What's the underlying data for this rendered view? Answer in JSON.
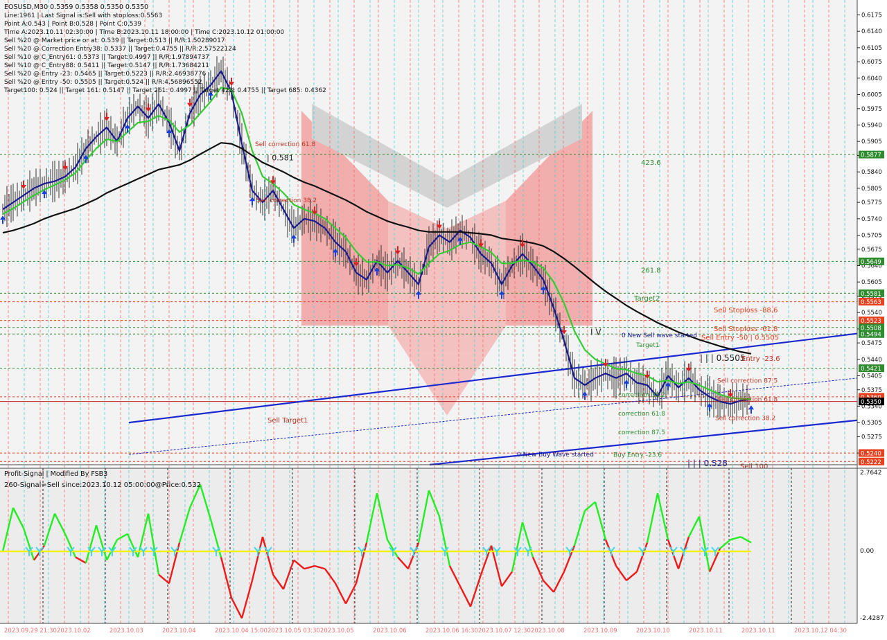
{
  "main_header": {
    "symbol_line": "EOSUSD,M30  0.5359 0.5358 0.5350 0.5350",
    "info_lines": [
      "Line:1961 | Last Signal is:Sell with stoploss:0.5563",
      "Point A:0.543 | Point B:0.528 | Point C:0.539",
      "Time A:2023.10.11 02:30:00 | Time B:2023.10.11 18:00:00 | Time C:2023.10.12 01:00:00",
      "Sell %20 @ Market price or at: 0.539 || Target:0.513 || R/R:1.50289017",
      "Sell %20 @ Correction Entry38: 0.5337 || Target:0.4755 || R/R:2.57522124",
      "Sell %10 @ C_Entry61: 0.5373 || Target:0.4997 || R/R:1.97894737",
      "Sell %10 @ C_Entry88: 0.5411 || Target:0.5147 || R/R:1.73684211",
      "Sell %20 @ Entry -23: 0.5465 || Target:0.5223 || R/R:2.46938776",
      "Sell %20 @ Entry -50: 0.5505 || Target:0.524 || R/R:4.56896552",
      "Target100: 0.524 || Target 161: 0.5147 || Target 261: 0.4997 || Target 423: 0.4755 || Target 685: 0.4362"
    ]
  },
  "price_axis": {
    "ticks": [
      "0.6175",
      "0.6140",
      "0.6105",
      "0.6075",
      "0.6040",
      "0.6005",
      "0.5975",
      "0.5940",
      "0.5905",
      "0.5875",
      "0.5840",
      "0.5805",
      "0.5775",
      "0.5740",
      "0.5705",
      "0.5675",
      "0.5640",
      "0.5605",
      "0.5575",
      "0.5540",
      "0.5505",
      "0.5475",
      "0.5440",
      "0.5405",
      "0.5375",
      "0.5340",
      "0.5305",
      "0.5275",
      "0.5240"
    ],
    "tags": [
      {
        "label": "0.5877",
        "bg": "#2e8b2e"
      },
      {
        "label": "0.5649",
        "bg": "#2e8b2e"
      },
      {
        "label": "0.5581",
        "bg": "#2e8b2e"
      },
      {
        "label": "0.5563",
        "bg": "#e8401c"
      },
      {
        "label": "0.5523",
        "bg": "#e8401c"
      },
      {
        "label": "0.5508",
        "bg": "#2e8b2e"
      },
      {
        "label": "0.5494",
        "bg": "#2e8b2e"
      },
      {
        "label": "0.5421",
        "bg": "#2e8b2e"
      },
      {
        "label": "0.5360",
        "bg": "#e8401c"
      },
      {
        "label": "0.5350",
        "bg": "#000000"
      },
      {
        "label": "0.5240",
        "bg": "#e8401c"
      },
      {
        "label": "0.5222",
        "bg": "#e8401c"
      }
    ]
  },
  "chart_labels": [
    {
      "text": "Sell correction 61.8",
      "color": "#c03020"
    },
    {
      "text": "| 0.581",
      "color": "#222222"
    },
    {
      "text": "Sell correction 38.2",
      "color": "#c03020"
    },
    {
      "text": "423.6",
      "color": "#2e8b2e"
    },
    {
      "text": "261.8",
      "color": "#2e8b2e"
    },
    {
      "text": "Target2",
      "color": "#2e8b2e"
    },
    {
      "text": "Sell Stoploss -88.6",
      "color": "#e8401c"
    },
    {
      "text": "Sell Stoploss -61.8",
      "color": "#e8401c"
    },
    {
      "text": "Sell Entry -50 | 0.5505",
      "color": "#e8401c"
    },
    {
      "text": "0 New Sell wave started",
      "color": "#1a1a90"
    },
    {
      "text": "Target1",
      "color": "#2e8b2e"
    },
    {
      "text": "| | | 0.5505",
      "color": "#222222"
    },
    {
      "text": "Entry -23.6",
      "color": "#c03020"
    },
    {
      "text": "I V",
      "color": "#222222"
    },
    {
      "text": "Sell correction 87.5",
      "color": "#c03020"
    },
    {
      "text": "Sell correction 61.8",
      "color": "#c03020"
    },
    {
      "text": "Sell correction 38.2",
      "color": "#c03020"
    },
    {
      "text": "correction 38.2",
      "color": "#2e8b2e"
    },
    {
      "text": "correction 61.8",
      "color": "#2e8b2e"
    },
    {
      "text": "correction 87.5",
      "color": "#2e8b2e"
    },
    {
      "text": "Sell Target1",
      "color": "#c03020"
    },
    {
      "text": "0 New Buy Wave started",
      "color": "#1a1a90"
    },
    {
      "text": "Buy Entry -23.6",
      "color": "#2e8b2e"
    },
    {
      "text": "| | | 0.528",
      "color": "#1a1a90"
    },
    {
      "text": "Sell 100",
      "color": "#c03020"
    }
  ],
  "sub_header": {
    "title": "Profit-Signal | Modified By FSB3",
    "signal": "260-Signal=Sell since:2023.10.12 05:00:00@Price:0.532"
  },
  "sub_axis": {
    "top": "2.7642",
    "zero": "0.00",
    "bottom": "-2.4287"
  },
  "time_axis": [
    "2023.09.29 21:30",
    "2023.10.02",
    "2023.10.03",
    "2023.10.04",
    "2023.10.04 15:00",
    "2023.10.05 03:30",
    "2023.10.05",
    "2023.10.06",
    "2023.10.06 16:30",
    "2023.10.07 12:30",
    "2023.10.08",
    "2023.10.09",
    "2023.10.10",
    "2023.10.11",
    "2023.10.11",
    "2023.10.12 04:30"
  ],
  "chart_data": [
    {
      "type": "line",
      "title": "EOSUSD,M30",
      "ylim": [
        0.5215,
        0.6195
      ],
      "x": [
        0,
        15,
        30,
        45,
        60,
        75,
        90,
        105,
        120,
        135,
        150,
        165,
        180,
        195,
        210,
        225,
        240,
        255,
        270,
        285,
        300,
        315,
        330,
        345,
        360,
        375,
        390,
        405,
        420,
        435,
        450,
        465,
        480,
        495,
        510,
        525,
        540,
        555,
        570,
        585,
        600,
        615,
        630,
        645,
        660,
        675,
        690,
        705,
        720,
        735,
        750,
        765,
        780,
        795,
        810,
        825,
        840,
        855,
        870,
        885,
        900,
        915,
        930,
        945,
        960,
        975,
        990,
        1005,
        1020,
        1035,
        1050,
        1065,
        1080
      ],
      "series": [
        {
          "values": [
            0.576,
            0.5775,
            0.579,
            0.5805,
            0.5815,
            0.582,
            0.583,
            0.585,
            0.589,
            0.5915,
            0.5935,
            0.5905,
            0.5955,
            0.598,
            0.5955,
            0.5985,
            0.5945,
            0.5885,
            0.5965,
            0.6005,
            0.6025,
            0.6055,
            0.601,
            0.59,
            0.58,
            0.5775,
            0.58,
            0.576,
            0.572,
            0.574,
            0.5735,
            0.572,
            0.569,
            0.567,
            0.5625,
            0.561,
            0.565,
            0.5625,
            0.565,
            0.5625,
            0.56,
            0.568,
            0.5705,
            0.569,
            0.5715,
            0.57,
            0.5665,
            0.5645,
            0.56,
            0.564,
            0.5665,
            0.564,
            0.561,
            0.555,
            0.548,
            0.54,
            0.5385,
            0.54,
            0.541,
            0.54,
            0.541,
            0.539,
            0.5385,
            0.536,
            0.5405,
            0.538,
            0.54,
            0.5375,
            0.536,
            0.535,
            0.5345,
            0.5352,
            0.5355
          ]
        },
        {
          "values": [
            0.575,
            0.5762,
            0.5776,
            0.579,
            0.5802,
            0.5812,
            0.5823,
            0.5838,
            0.5865,
            0.589,
            0.591,
            0.5905,
            0.5925,
            0.5945,
            0.5948,
            0.596,
            0.595,
            0.5925,
            0.594,
            0.5965,
            0.599,
            0.602,
            0.6015,
            0.5965,
            0.5885,
            0.583,
            0.5815,
            0.5795,
            0.577,
            0.576,
            0.5752,
            0.574,
            0.572,
            0.57,
            0.567,
            0.5648,
            0.5648,
            0.564,
            0.5642,
            0.5635,
            0.5622,
            0.5645,
            0.5665,
            0.5672,
            0.5685,
            0.569,
            0.568,
            0.5668,
            0.5645,
            0.5645,
            0.5652,
            0.5648,
            0.5635,
            0.5605,
            0.556,
            0.55,
            0.546,
            0.544,
            0.543,
            0.542,
            0.5418,
            0.541,
            0.5405,
            0.5392,
            0.5395,
            0.5388,
            0.5392,
            0.5385,
            0.5375,
            0.5365,
            0.5358,
            0.5356,
            0.5355
          ]
        },
        {
          "values": [
            0.571,
            0.5715,
            0.5722,
            0.573,
            0.574,
            0.5748,
            0.5755,
            0.5762,
            0.5772,
            0.5782,
            0.5795,
            0.5805,
            0.5815,
            0.5825,
            0.5835,
            0.5845,
            0.585,
            0.5855,
            0.5865,
            0.5878,
            0.589,
            0.5902,
            0.59,
            0.589,
            0.5875,
            0.586,
            0.585,
            0.584,
            0.5828,
            0.5818,
            0.581,
            0.58,
            0.579,
            0.578,
            0.5768,
            0.5755,
            0.5745,
            0.5735,
            0.5728,
            0.5722,
            0.5715,
            0.5712,
            0.5712,
            0.5712,
            0.5712,
            0.571,
            0.5708,
            0.5705,
            0.5698,
            0.5695,
            0.5692,
            0.5688,
            0.5682,
            0.567,
            0.5655,
            0.5638,
            0.562,
            0.5602,
            0.5585,
            0.557,
            0.5555,
            0.5542,
            0.553,
            0.5518,
            0.5508,
            0.5498,
            0.549,
            0.5482,
            0.5475,
            0.5468,
            0.5462,
            0.5456,
            0.5452
          ]
        }
      ]
    },
    {
      "type": "line",
      "title": "Profit-Signal | Modified By FSB3",
      "ylim": [
        -2.4287,
        2.7642
      ],
      "x": [
        0,
        15,
        30,
        45,
        60,
        75,
        90,
        105,
        120,
        135,
        150,
        165,
        180,
        195,
        210,
        225,
        240,
        255,
        270,
        285,
        300,
        315,
        330,
        345,
        360,
        375,
        390,
        405,
        420,
        435,
        450,
        465,
        480,
        495,
        510,
        525,
        540,
        555,
        570,
        585,
        600,
        615,
        630,
        645,
        660,
        675,
        690,
        705,
        720,
        735,
        750,
        765,
        780,
        795,
        810,
        825,
        840,
        855,
        870,
        885,
        900,
        915,
        930,
        945,
        960,
        975,
        990,
        1005,
        1020,
        1035,
        1050,
        1065,
        1080
      ],
      "series": [
        {
          "values": [
            0.0,
            1.5,
            0.8,
            -0.3,
            0.2,
            1.3,
            0.6,
            -0.2,
            -0.4,
            0.9,
            -0.3,
            0.4,
            0.6,
            -0.2,
            1.3,
            -0.8,
            -1.1,
            0.3,
            1.5,
            2.3,
            1.1,
            -0.2,
            -1.6,
            -2.3,
            -1.0,
            0.5,
            -0.8,
            -1.3,
            -0.3,
            -0.6,
            -0.5,
            -0.6,
            -1.1,
            -1.8,
            -1.1,
            0.3,
            2.0,
            0.4,
            -0.2,
            -0.6,
            0.3,
            2.1,
            1.2,
            -0.5,
            -1.2,
            -1.9,
            -0.8,
            0.2,
            -1.2,
            -0.7,
            1.0,
            -0.2,
            -1.0,
            -1.4,
            -0.7,
            0.2,
            1.4,
            1.7,
            0.4,
            -0.5,
            -1.0,
            -0.7,
            0.3,
            2.0,
            0.4,
            -0.6,
            0.5,
            1.2,
            -0.7,
            0.1,
            0.4,
            0.5,
            0.3
          ]
        }
      ]
    }
  ]
}
